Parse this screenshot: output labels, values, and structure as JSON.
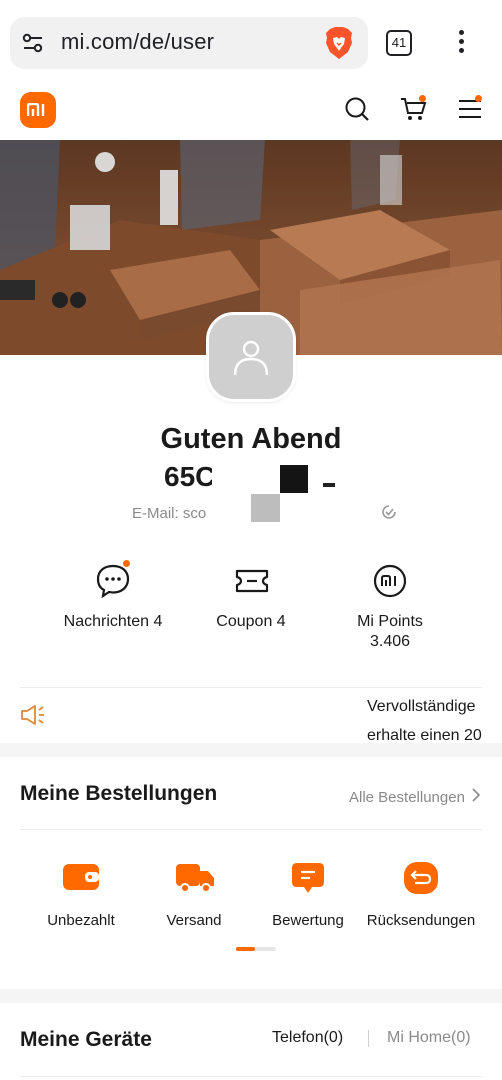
{
  "browser": {
    "url": "mi.com/de/user",
    "tab_count": "41"
  },
  "header": {
    "logo": "mi",
    "icons": [
      "search-icon",
      "cart-icon",
      "menu-icon"
    ]
  },
  "profile": {
    "greeting": "Guten Abend",
    "user_id": "65C",
    "email": "E-Mail: sco"
  },
  "stats": [
    {
      "label": "Nachrichten 4"
    },
    {
      "label": "Coupon 4"
    },
    {
      "label_line1": "Mi Points",
      "label_line2": "3.406"
    }
  ],
  "notice": {
    "line1": "Vervollständige",
    "line2": "erhalte einen 20"
  },
  "orders": {
    "title": "Meine Bestellungen",
    "all_link": "Alle Bestellungen",
    "items": [
      {
        "label": "Unbezahlt"
      },
      {
        "label": "Versand"
      },
      {
        "label": "Bewertung"
      },
      {
        "label": "Rücksendungen"
      }
    ]
  },
  "devices": {
    "title": "Meine Geräte",
    "tab_phone": "Telefon(0)",
    "tab_mihome": "Mi Home(0)"
  },
  "colors": {
    "accent": "#ff6900",
    "muted": "#8a8a8a"
  }
}
